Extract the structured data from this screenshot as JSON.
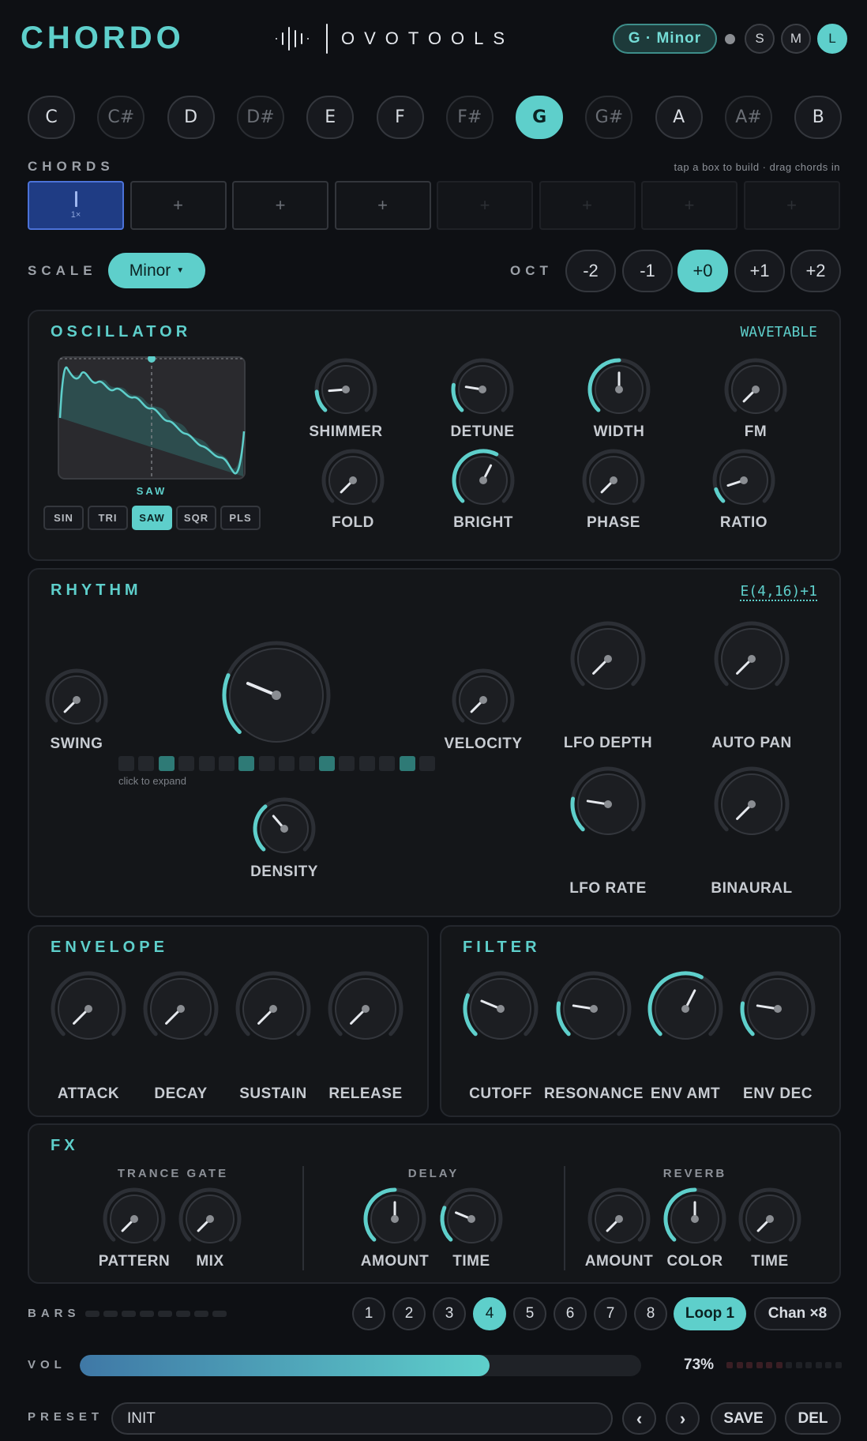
{
  "header": {
    "brand": "CHORDO",
    "logo_text": "OVOTOOLS",
    "key": "G · Minor",
    "modes": [
      {
        "label": "S",
        "active": false
      },
      {
        "label": "M",
        "active": false
      },
      {
        "label": "L",
        "active": true
      }
    ]
  },
  "notes": [
    {
      "label": "C",
      "sharp": false,
      "active": false
    },
    {
      "label": "C#",
      "sharp": true,
      "active": false
    },
    {
      "label": "D",
      "sharp": false,
      "active": false
    },
    {
      "label": "D#",
      "sharp": true,
      "active": false
    },
    {
      "label": "E",
      "sharp": false,
      "active": false
    },
    {
      "label": "F",
      "sharp": false,
      "active": false
    },
    {
      "label": "F#",
      "sharp": true,
      "active": false
    },
    {
      "label": "G",
      "sharp": false,
      "active": true
    },
    {
      "label": "G#",
      "sharp": true,
      "active": false
    },
    {
      "label": "A",
      "sharp": false,
      "active": false
    },
    {
      "label": "A#",
      "sharp": true,
      "active": false
    },
    {
      "label": "B",
      "sharp": false,
      "active": false
    }
  ],
  "chords": {
    "label": "CHORDS",
    "hint": "tap a box to build · drag chords in",
    "active_sub": "1×",
    "slot_symbol": "+"
  },
  "scale": {
    "label": "SCALE",
    "value": "Minor",
    "oct_label": "OCT",
    "octaves": [
      {
        "label": "-2",
        "active": false
      },
      {
        "label": "-1",
        "active": false
      },
      {
        "label": "+0",
        "active": true
      },
      {
        "label": "+1",
        "active": false
      },
      {
        "label": "+2",
        "active": false
      }
    ]
  },
  "oscillator": {
    "title": "OSCILLATOR",
    "mode": "WAVETABLE",
    "wave_name": "SAW",
    "waves": [
      {
        "label": "SIN",
        "active": false
      },
      {
        "label": "TRI",
        "active": false
      },
      {
        "label": "SAW",
        "active": true
      },
      {
        "label": "SQR",
        "active": false
      },
      {
        "label": "PLS",
        "active": false
      }
    ],
    "knobs": [
      {
        "label": "SHIMMER",
        "value": 0.15
      },
      {
        "label": "DETUNE",
        "value": 0.2
      },
      {
        "label": "WIDTH",
        "value": 0.5
      },
      {
        "label": "FM",
        "value": 0.0
      },
      {
        "label": "FOLD",
        "value": 0.0
      },
      {
        "label": "BRIGHT",
        "value": 0.6
      },
      {
        "label": "PHASE",
        "value": 0.0
      },
      {
        "label": "RATIO",
        "value": 0.1
      }
    ]
  },
  "rhythm": {
    "title": "RHYTHM",
    "pattern": "E(4,16)+1",
    "expand_hint": "click to expand",
    "steps": [
      0,
      0,
      1,
      0,
      0,
      0,
      1,
      0,
      0,
      0,
      1,
      0,
      0,
      0,
      1,
      0
    ],
    "knobs": {
      "swing": {
        "label": "SWING",
        "value": 0.0
      },
      "main": {
        "value": 0.25
      },
      "density": {
        "label": "DENSITY",
        "value": 0.35
      },
      "velocity": {
        "label": "VELOCITY",
        "value": 0.0
      },
      "lfo_depth": {
        "label": "LFO DEPTH",
        "value": 0.0
      },
      "auto_pan": {
        "label": "AUTO PAN",
        "value": 0.0
      },
      "lfo_rate": {
        "label": "LFO RATE",
        "value": 0.2
      },
      "binaural": {
        "label": "BINAURAL",
        "value": 0.0
      }
    }
  },
  "envelope": {
    "title": "ENVELOPE",
    "knobs": [
      {
        "label": "ATTACK",
        "value": 0.0
      },
      {
        "label": "DECAY",
        "value": 0.0
      },
      {
        "label": "SUSTAIN",
        "value": 0.0
      },
      {
        "label": "RELEASE",
        "value": 0.0
      }
    ]
  },
  "filter": {
    "title": "FILTER",
    "knobs": [
      {
        "label": "CUTOFF",
        "value": 0.25
      },
      {
        "label": "RESONANCE",
        "value": 0.2
      },
      {
        "label": "ENV AMT",
        "value": 0.6
      },
      {
        "label": "ENV DEC",
        "value": 0.2
      }
    ]
  },
  "fx": {
    "title": "FX",
    "groups": [
      {
        "title": "TRANCE GATE",
        "knobs": [
          {
            "label": "PATTERN",
            "value": 0.0
          },
          {
            "label": "MIX",
            "value": 0.0
          }
        ]
      },
      {
        "title": "DELAY",
        "knobs": [
          {
            "label": "AMOUNT",
            "value": 0.5
          },
          {
            "label": "TIME",
            "value": 0.25
          }
        ]
      },
      {
        "title": "REVERB",
        "knobs": [
          {
            "label": "AMOUNT",
            "value": 0.0
          },
          {
            "label": "COLOR",
            "value": 0.5
          },
          {
            "label": "TIME",
            "value": 0.0
          }
        ]
      }
    ]
  },
  "bars": {
    "label": "BARS",
    "options": [
      {
        "label": "1",
        "active": false
      },
      {
        "label": "2",
        "active": false
      },
      {
        "label": "3",
        "active": false
      },
      {
        "label": "4",
        "active": true
      },
      {
        "label": "5",
        "active": false
      },
      {
        "label": "6",
        "active": false
      },
      {
        "label": "7",
        "active": false
      },
      {
        "label": "8",
        "active": false
      }
    ],
    "loop": "Loop 1",
    "chan": "Chan ×8"
  },
  "volume": {
    "label": "VOL",
    "value": 0.73,
    "display": "73%"
  },
  "preset": {
    "label": "PRESET",
    "name": "INIT",
    "prev": "‹",
    "next": "›",
    "save": "SAVE",
    "del": "DEL"
  },
  "colors": {
    "accent": "#5ecfcb",
    "panel": "#141619",
    "chord_active": "#1f3c84"
  }
}
